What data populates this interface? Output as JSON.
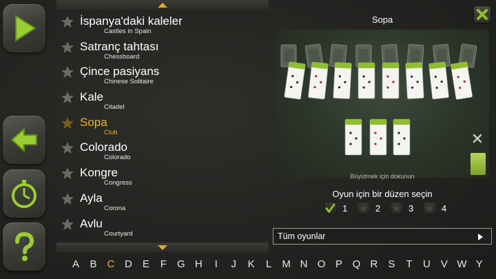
{
  "games": [
    {
      "name": "İspanya'daki kaleler",
      "sub": "Castles in Spain",
      "selected": false
    },
    {
      "name": "Satranç tahtası",
      "sub": "Chessboard",
      "selected": false
    },
    {
      "name": "Çince pasiyans",
      "sub": "Chinese Solitaire",
      "selected": false
    },
    {
      "name": "Kale",
      "sub": "Citadel",
      "selected": false
    },
    {
      "name": "Sopa",
      "sub": "Club",
      "selected": true
    },
    {
      "name": "Colorado",
      "sub": "Colorado",
      "selected": false
    },
    {
      "name": "Kongre",
      "sub": "Congress",
      "selected": false
    },
    {
      "name": "Ayla",
      "sub": "Corona",
      "selected": false
    },
    {
      "name": "Avlu",
      "sub": "Courtyard",
      "selected": false
    }
  ],
  "alphabet": [
    "A",
    "B",
    "C",
    "D",
    "E",
    "F",
    "G",
    "H",
    "I",
    "J",
    "K",
    "L",
    "M",
    "N",
    "O",
    "P",
    "Q",
    "R",
    "S",
    "T",
    "U",
    "V",
    "W",
    "Y"
  ],
  "active_letter": "C",
  "preview": {
    "title": "Sopa",
    "hint": "Büyütmek için dokunun"
  },
  "layout": {
    "label": "Oyun için bir düzen seçin",
    "options": [
      "1",
      "2",
      "3",
      "4"
    ],
    "selected": "1"
  },
  "all_games_label": "Tüm oyunlar",
  "colors": {
    "accent": "#f0b22a",
    "green": "#8fbf2e",
    "felt": "#2c352a"
  },
  "icons": {
    "play": "play-icon",
    "back": "back-arrow-icon",
    "timer": "stopwatch-icon",
    "help": "question-icon",
    "close": "close-icon",
    "star": "star-icon"
  }
}
